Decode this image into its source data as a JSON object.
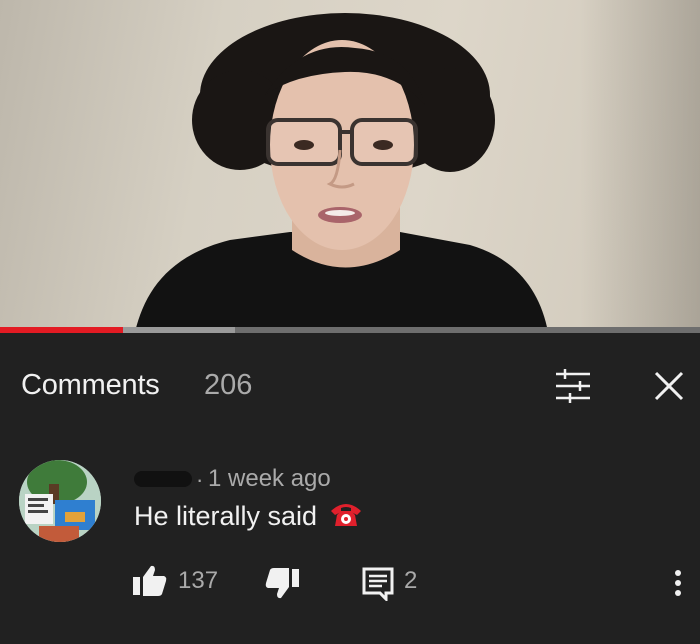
{
  "video": {
    "progress_fraction": 0.175,
    "buffer_fraction": 0.335,
    "colors": {
      "played": "#e31b23",
      "buffered": "#9a9a9a",
      "track": "#6e6e6e"
    }
  },
  "comments_panel": {
    "title": "Comments",
    "count": "206",
    "sort_icon": "sort-filter-icon",
    "close_icon": "close-icon"
  },
  "comment": {
    "author_redacted": true,
    "separator": "·",
    "time": "1 week ago",
    "text": "He literally said",
    "emoji": "telephone-receiver-emoji",
    "likes": "137",
    "replies": "2",
    "icons": [
      "thumbs-up-icon",
      "thumbs-down-icon",
      "reply-icon",
      "more-vertical-icon"
    ]
  }
}
